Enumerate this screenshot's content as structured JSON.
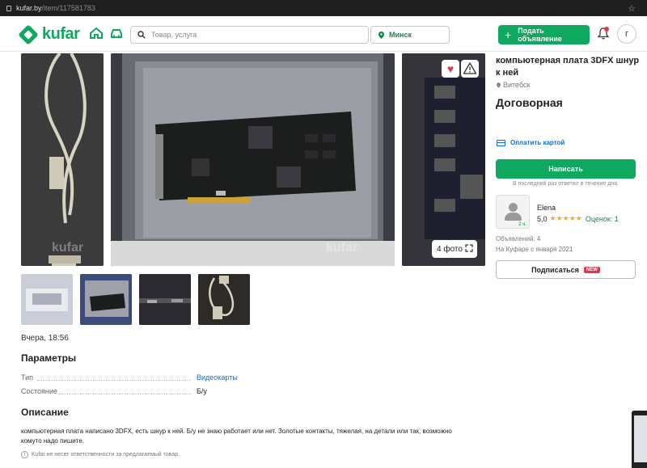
{
  "browser": {
    "url_host": "kufar.by",
    "url_path": "/item/117581783"
  },
  "header": {
    "logo_text": "kufar",
    "search_placeholder": "Товар, услуга",
    "location": "Минск",
    "post_button": "Подать объявление",
    "user_initial": "г"
  },
  "gallery": {
    "watermark": "kufar",
    "photo_count": "4 фото"
  },
  "item": {
    "posted": "Вчера, 18:56",
    "title": "компьютерная плата 3DFX шнур к ней",
    "city": "Витебск",
    "price": "Договорная"
  },
  "params": {
    "heading": "Параметры",
    "rows": [
      {
        "key": "Тип",
        "value": "Видеокарты"
      },
      {
        "key": "Состояние",
        "value": "Б/у"
      }
    ]
  },
  "description": {
    "heading": "Описание",
    "text": "компьютерная плата написано 3DFX, есть шнур к ней. Б/у не знаю работает или нет. Золотые контакты, тяжелая, на детали или так, возможно комуто надо пишите.",
    "disclaimer": "Kufar не несет ответственности за предлагаемый товар."
  },
  "sidebar": {
    "pay_card": "Оплатить картой",
    "write_button": "Написать",
    "last_seen": "В последний раз ответил в течение дня.",
    "seller": {
      "name": "Elena",
      "rating": "5,0",
      "stars": "★★★★★",
      "reviews": "Оценок: 1",
      "age_badge": "2 ч.",
      "ads": "Объявлений: 4",
      "since": "На Куфаре с января 2021"
    },
    "subscribe_button": "Подписаться",
    "new_badge": "NEW"
  },
  "colors": {
    "brand_green": "#0ea85e",
    "link_blue": "#0b6ed6",
    "alert_red": "#e3374f",
    "star": "#f5a623"
  }
}
